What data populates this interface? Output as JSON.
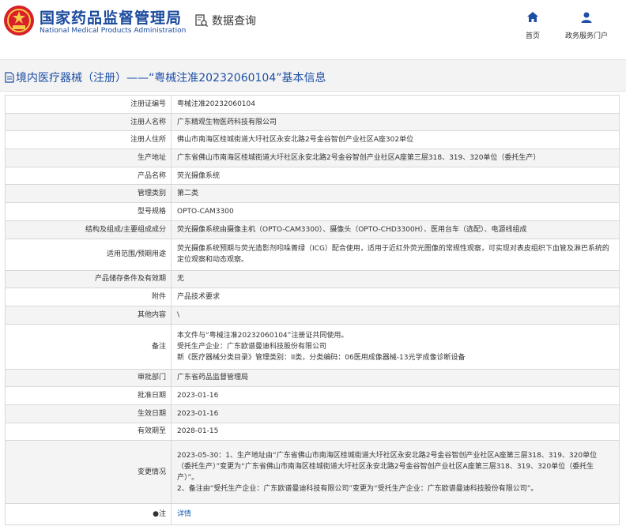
{
  "header": {
    "site_title": "国家药品监督管理局",
    "site_subtitle": "National Medical Products Administration",
    "query_label": "数据查询",
    "nav": [
      {
        "label": "首页",
        "icon": "home-icon"
      },
      {
        "label": "政务服务门户",
        "icon": "user-icon"
      }
    ]
  },
  "page_title": "境内医疗器械（注册）——“粤械注准20232060104”基本信息",
  "rows": [
    {
      "label": "注册证编号",
      "value": "粤械注准20232060104"
    },
    {
      "label": "注册人名称",
      "value": "广东精观生物医药科技有限公司"
    },
    {
      "label": "注册人住所",
      "value": "佛山市南海区桂城街道大圩社区永安北路2号金谷智创产业社区A座302单位"
    },
    {
      "label": "生产地址",
      "value": "广东省佛山市南海区桂城街道大圩社区永安北路2号金谷智创产业社区A座第三层318、319、320单位（委托生产）"
    },
    {
      "label": "产品名称",
      "value": "荧光摄像系统"
    },
    {
      "label": "管理类别",
      "value": "第二类"
    },
    {
      "label": "型号规格",
      "value": "OPTO-CAM3300"
    },
    {
      "label": "结构及组成/主要组成成分",
      "value": "荧光摄像系统由摄像主机（OPTO-CAM3300）、摄像头（OPTO-CHD3300H）、医用台车（选配）、电源线组成"
    },
    {
      "label": "适用范围/预期用途",
      "value": "荧光摄像系统预期与荧光造影剂吲哚菁绿（ICG）配合使用，适用于近红外荧光图像的常规性观察，可实现对表皮组织下血管及淋巴系统的定位观察和动态观察。"
    },
    {
      "label": "产品储存条件及有效期",
      "value": "无"
    },
    {
      "label": "附件",
      "value": "产品技术要求"
    },
    {
      "label": "其他内容",
      "value": "\\"
    },
    {
      "label": "备注",
      "lines": [
        "本文件与“粤械注准20232060104”注册证共同使用。",
        "受托生产企业：广东欧谱曼迪科技股份有限公司",
        "新《医疗器械分类目录》管理类别：II类，分类编码：06医用成像器械-13光学成像诊断设备"
      ]
    },
    {
      "label": "审批部门",
      "value": "广东省药品监督管理局"
    },
    {
      "label": "批准日期",
      "value": "2023-01-16"
    },
    {
      "label": "生效日期",
      "value": "2023-01-16"
    },
    {
      "label": "有效期至",
      "value": "2028-01-15"
    },
    {
      "label": "变更情况",
      "lines": [
        "2023-05-30：1、生产地址由“广东省佛山市南海区桂城街道大圩社区永安北路2号金谷智创产业社区A座第三层318、319、320单位（委托生产）”变更为“广东省佛山市南海区桂城街道大圩社区永安北路2号金谷智创产业社区A座第三层318、319、320单位（委托生产）”。",
        "2、备注由“受托生产企业：广东欧谱曼迪科技有限公司”变更为“受托生产企业：广东欧谱曼迪科技股份有限公司”。"
      ]
    },
    {
      "label": "●注",
      "value": "详情",
      "is_link": true
    }
  ]
}
